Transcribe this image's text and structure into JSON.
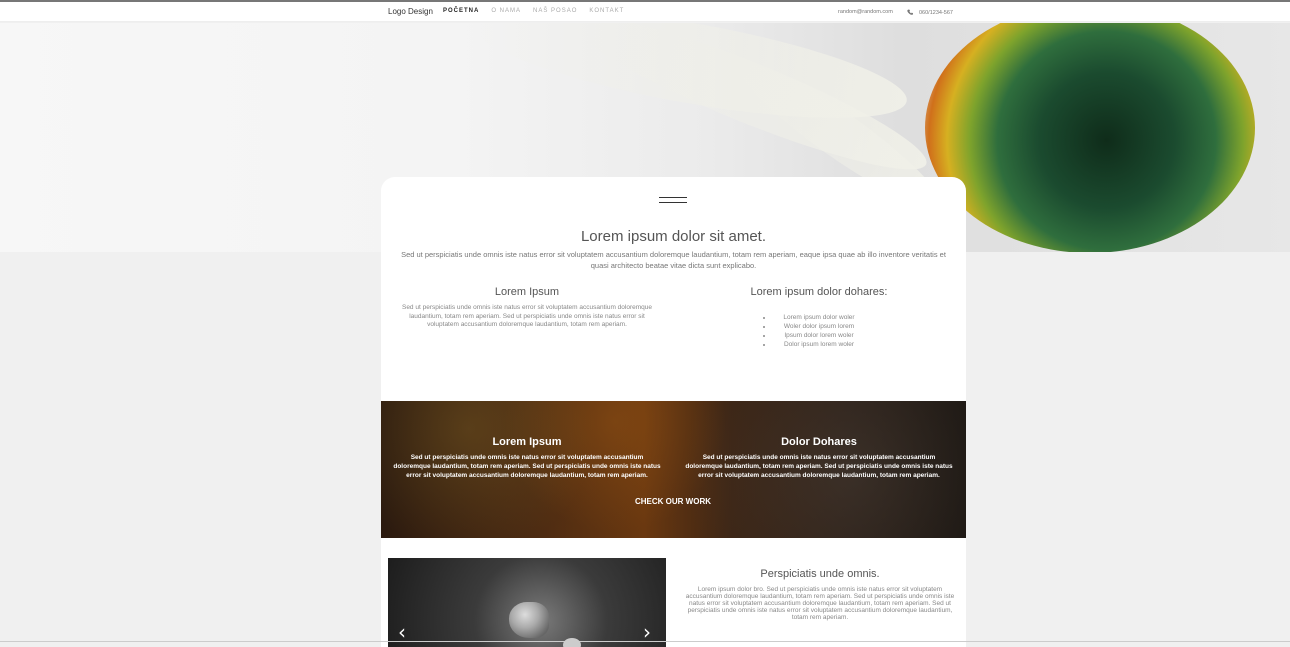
{
  "nav": {
    "logo": "Logo Design",
    "items": [
      "POČETNA",
      "O NAMA",
      "NAŠ POSAO",
      "KONTAKT"
    ],
    "email": "random@random.com",
    "phone": "060/1234-567"
  },
  "hero_card": {
    "title": "Lorem ipsum dolor sit amet.",
    "subtitle": "Sed ut perspiciatis unde omnis iste natus error sit voluptatem accusantium doloremque laudantium, totam rem aperiam, eaque ipsa quae ab illo inventore veritatis et quasi architecto beatae vitae dicta sunt explicabo."
  },
  "columns": {
    "left": {
      "title": "Lorem Ipsum",
      "text": "Sed ut perspiciatis unde omnis iste natus error sit voluptatem accusantium doloremque laudantium, totam rem aperiam. Sed ut perspiciatis unde omnis iste natus error sit voluptatem accusantium doloremque laudantium, totam rem aperiam."
    },
    "right": {
      "title": "Lorem ipsum dolor dohares:",
      "list": [
        "Lorem ipsum dolor woler",
        "Woler dolor ipsum lorem",
        "Ipsum dolor lorem woler",
        "Dolor ipsum lorem woler"
      ]
    }
  },
  "band": {
    "left_title": "Lorem Ipsum",
    "left_text": "Sed ut perspiciatis unde omnis iste natus error sit voluptatem accusantium doloremque laudantium, totam rem aperiam. Sed ut perspiciatis unde omnis iste natus error sit voluptatem accusantium doloremque laudantium, totam rem aperiam.",
    "right_title": "Dolor Dohares",
    "right_text": "Sed ut perspiciatis unde omnis iste natus error sit voluptatem accusantium doloremque laudantium, totam rem aperiam. Sed ut perspiciatis unde omnis iste natus error sit voluptatem accusantium doloremque laudantium, totam rem aperiam.",
    "cta": "CHECK OUR WORK"
  },
  "slider": {
    "prev_glyph": "‹",
    "next_glyph": "›"
  },
  "persp": {
    "title": "Perspiciatis unde omnis.",
    "text": "Lorem ipsum dolor bro. Sed ut perspiciatis unde omnis iste natus error sit voluptatem accusantium doloremque laudantium, totam rem aperiam. Sed ut perspiciatis unde omnis iste natus error sit voluptatem accusantium doloremque laudantium, totam rem aperiam. Sed ut perspiciatis unde omnis iste natus error sit voluptatem accusantium doloremque laudantium, totam rem aperiam."
  },
  "colors": {
    "accent": "#333333",
    "band_dark": "#2b1a0f",
    "flower_green": "#1b4b2f",
    "flower_orange": "#d0701b"
  },
  "icons": {
    "phone": "phone-icon",
    "menu": "hamburger-icon"
  }
}
